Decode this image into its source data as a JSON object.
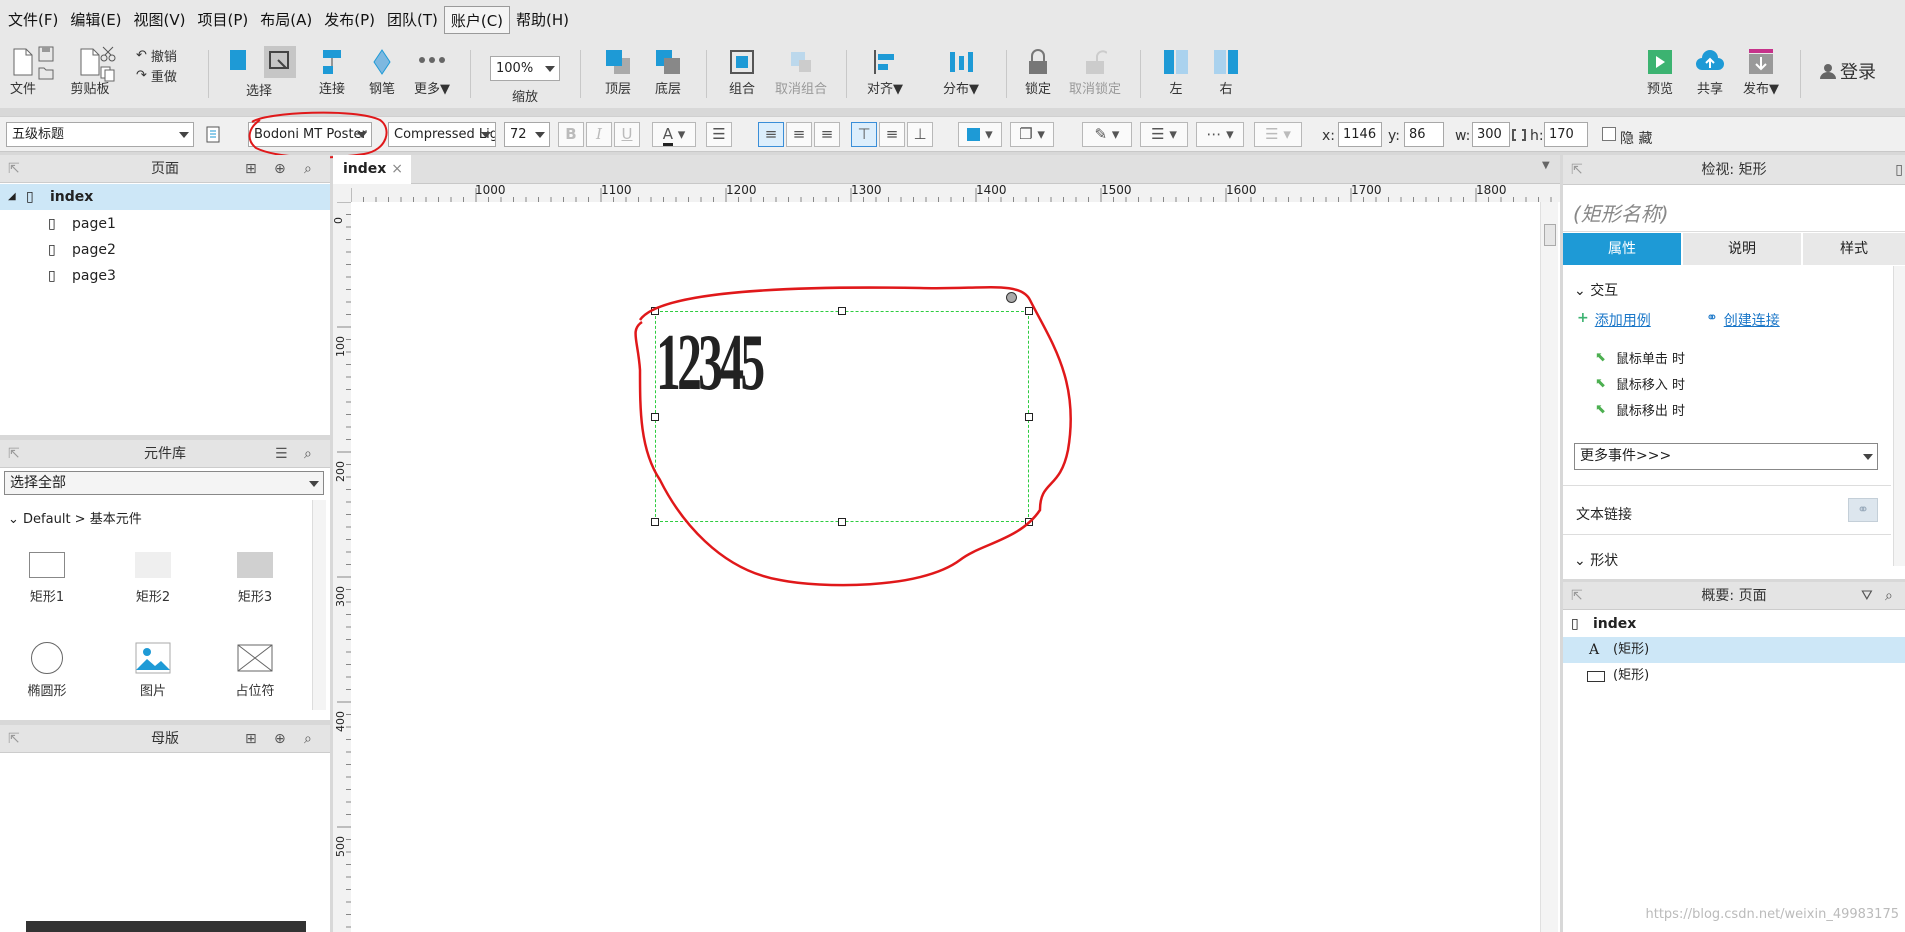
{
  "menu": [
    "文件(F)",
    "编辑(E)",
    "视图(V)",
    "项目(P)",
    "布局(A)",
    "发布(P)",
    "团队(T)",
    "账户(C)",
    "帮助(H)"
  ],
  "toolbar": {
    "file": "文件",
    "clipboard": "剪贴板",
    "undo": "撤销",
    "redo": "重做",
    "select": "选择",
    "connect": "连接",
    "pen": "钢笔",
    "more": "更多▼",
    "zoom_value": "100%",
    "zoom_label": "缩放",
    "top": "顶层",
    "bottom": "底层",
    "group": "组合",
    "ungroup": "取消组合",
    "align": "对齐▼",
    "distribute": "分布▼",
    "lock": "锁定",
    "unlock": "取消锁定",
    "left": "左",
    "right": "右",
    "preview": "预览",
    "share": "共享",
    "publish": "发布▼",
    "login": "登录"
  },
  "format": {
    "style": "五级标题",
    "font_family": "Bodoni MT Poster",
    "font_weight": "Compressed Light",
    "font_size": "72",
    "x_label": "x:",
    "x": "1146",
    "y_label": "y:",
    "y": "86",
    "w_label": "w:",
    "w": "300",
    "h_label": "h:",
    "h": "170",
    "hidden": "隐 藏"
  },
  "pages_panel": {
    "title": "页面",
    "items": [
      "index",
      "page1",
      "page2",
      "page3"
    ]
  },
  "library_panel": {
    "title": "元件库",
    "filter": "选择全部",
    "group": "Default > 基本元件",
    "widgets": [
      "矩形1",
      "矩形2",
      "矩形3",
      "椭圆形",
      "图片",
      "占位符"
    ]
  },
  "masters_panel": {
    "title": "母版"
  },
  "canvas": {
    "tab": "index",
    "ruler_h": [
      "1000",
      "1100",
      "1200",
      "1300",
      "1400",
      "1500",
      "1600",
      "1700",
      "1800"
    ],
    "ruler_v": [
      "0",
      "100",
      "200",
      "300",
      "400",
      "500"
    ],
    "shape_text": "12345"
  },
  "inspector": {
    "title": "检视: 矩形",
    "name_placeholder": "(矩形名称)",
    "tabs": [
      "属性",
      "说明",
      "样式"
    ],
    "interaction": "交互",
    "add_case": "添加用例",
    "create_link": "创建连接",
    "events": [
      "鼠标单击 时",
      "鼠标移入 时",
      "鼠标移出 时"
    ],
    "more_events": "更多事件>>>",
    "text_link": "文本链接",
    "shape": "形状"
  },
  "outline": {
    "title": "概要: 页面",
    "page": "index",
    "items": [
      "(矩形)",
      "(矩形)"
    ]
  },
  "watermark": "https://blog.csdn.net/weixin_49983175",
  "colors": {
    "accent": "#1e9ad6",
    "annotation": "#e0181a",
    "selection": "#2ecc40"
  }
}
